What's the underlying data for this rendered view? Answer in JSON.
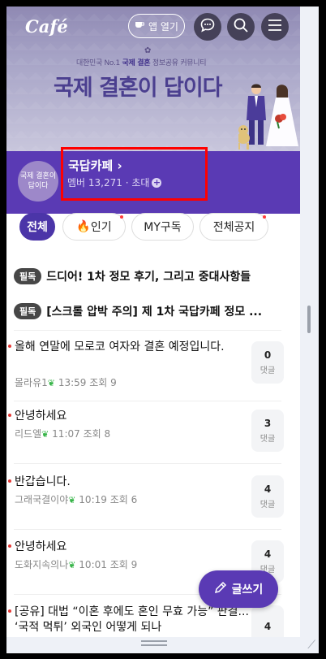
{
  "header": {
    "logo": "Café",
    "app_button_label": "앱 열기"
  },
  "banner": {
    "tagline_prefix": "대한민국 No.1 ",
    "tagline_emph": "국제 결혼",
    "tagline_suffix": " 정보공유 커뮤니티",
    "headline": "국제 결혼이 답이다"
  },
  "cafe": {
    "avatar_text": "국제 결혼이 답이다",
    "name": "국답카페",
    "chevron": "›",
    "meta": "멤버 13,271 · 초대",
    "plus": "+"
  },
  "tabs": [
    {
      "label": "전체",
      "active": true
    },
    {
      "label": "인기"
    },
    {
      "label": "MY구독"
    },
    {
      "label": "전체공지"
    }
  ],
  "notices": [
    {
      "badge": "필독",
      "text": "드디어! 1차 정모 후기, 그리고 중대사항들"
    },
    {
      "badge": "필독",
      "text": "[스크롤 압박 주의] 제 1차 국답카페 정모 ..."
    }
  ],
  "posts": [
    {
      "title": "올해 연말에 모로코 여자와 결혼 예정입니다.",
      "author": "몰라유1",
      "time": "13:59",
      "views": "조회 9",
      "comments": "0",
      "comment_label": "댓글"
    },
    {
      "title": "안녕하세요",
      "author": "리드엘",
      "time": "11:07",
      "views": "조회 8",
      "comments": "3",
      "comment_label": "댓글"
    },
    {
      "title": "반갑습니다.",
      "author": "그래국결이야",
      "time": "10:19",
      "views": "조회 6",
      "comments": "4",
      "comment_label": "댓글"
    },
    {
      "title": "안녕하세요",
      "author": "도화지속의나",
      "time": "10:01",
      "views": "조회 9",
      "comments": "4",
      "comment_label": "댓글"
    },
    {
      "title": "[공유] 대법 “이혼 후에도 혼인 무효 가능” 판결... ‘국적 먹튀’ 외국인 어떻게 되나",
      "author": "",
      "time": "",
      "views": "",
      "comments": "4",
      "comment_label": ""
    }
  ],
  "write_button_label": "글쓰기"
}
